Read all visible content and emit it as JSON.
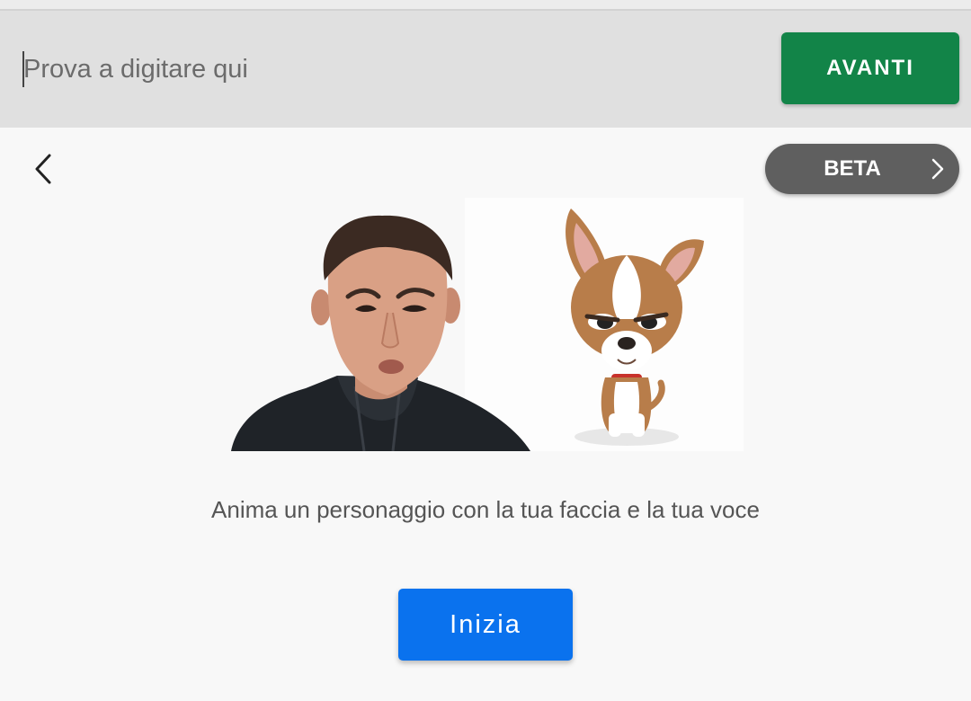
{
  "input_bar": {
    "placeholder": "Prova a digitare qui",
    "value": "",
    "next_button_label": "AVANTI"
  },
  "header": {
    "back_icon": "chevron-left-icon",
    "beta_label": "BETA",
    "beta_icon": "chevron-right-icon"
  },
  "main": {
    "illustration": {
      "left": "person-frowning-photo",
      "right": "cartoon-chihuahua-frowning"
    },
    "description": "Anima un personaggio con la tua faccia e la tua voce",
    "start_button_label": "Inizia"
  },
  "colors": {
    "next_button": "#128448",
    "start_button": "#0a72ee",
    "beta_pill": "#5f5f5f",
    "input_bar_bg": "#e0e0e0"
  }
}
